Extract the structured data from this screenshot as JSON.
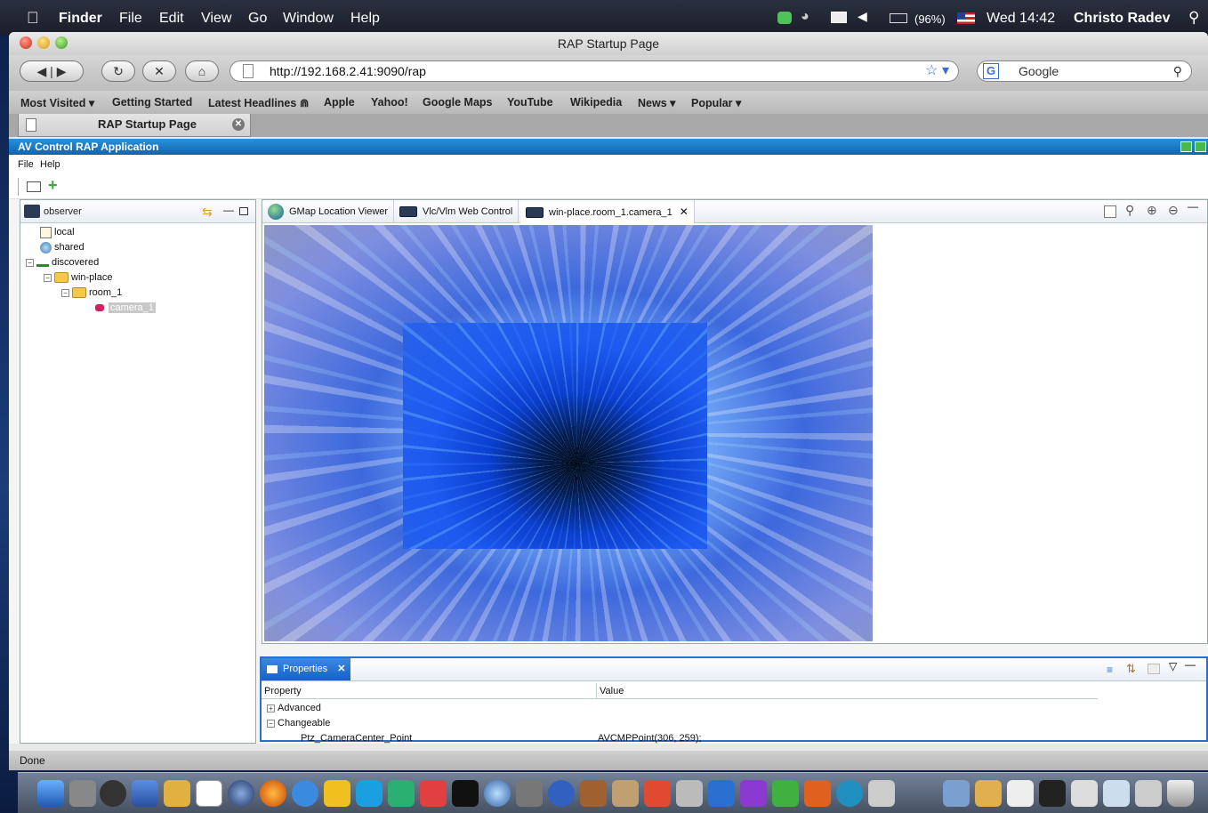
{
  "menubar": {
    "apple": "",
    "items": [
      "Finder",
      "File",
      "Edit",
      "View",
      "Go",
      "Window",
      "Help"
    ],
    "battery": "(96%)",
    "clock": "Wed 14:42",
    "user": "Christo Radev"
  },
  "window": {
    "title": "RAP Startup Page"
  },
  "nav": {
    "url": "http://192.168.2.41:9090/rap",
    "search_placeholder": "Google"
  },
  "bookmarks": [
    "Most Visited ▾",
    "Getting Started",
    "Latest Headlines ⋒",
    "Apple",
    "Yahoo!",
    "Google Maps",
    "YouTube",
    "Wikipedia",
    "News ▾",
    "Popular ▾"
  ],
  "tab": {
    "label": "RAP Startup Page"
  },
  "app": {
    "title": "AV Control RAP Application",
    "menu": [
      "File",
      "Help"
    ]
  },
  "observer": {
    "title": "observer",
    "tree": [
      {
        "label": "local"
      },
      {
        "label": "shared"
      },
      {
        "label": "discovered"
      },
      {
        "label": "win-place"
      },
      {
        "label": "room_1"
      },
      {
        "label": "camera_1"
      }
    ]
  },
  "editor": {
    "tabs": [
      "GMap Location Viewer",
      "Vlc/Vlm Web Control",
      "win-place.room_1.camera_1"
    ]
  },
  "properties": {
    "title": "Properties",
    "col_property": "Property",
    "col_value": "Value",
    "rows": [
      {
        "name": "Advanced",
        "value": ""
      },
      {
        "name": "Changeable",
        "value": ""
      },
      {
        "name": "Ptz_CameraCenter_Point",
        "value": "AVCMPPoint(306, 259);"
      }
    ]
  },
  "status": {
    "text": "Done"
  },
  "colors": {
    "rap_titlebar": "#1478c8",
    "selection": "#c8c8c8",
    "accent": "#2a6fd0"
  }
}
